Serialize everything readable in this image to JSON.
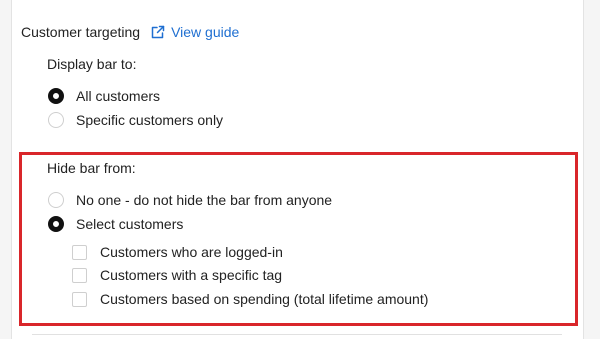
{
  "targeting": {
    "title": "Customer targeting",
    "guide_link": "View guide",
    "icon": "external-link-icon",
    "accent_color": "#1f6fd1"
  },
  "display_bar": {
    "label": "Display bar to:",
    "options": [
      {
        "label": "All customers",
        "selected": true
      },
      {
        "label": "Specific customers only",
        "selected": false
      }
    ]
  },
  "hide_bar": {
    "label": "Hide bar from:",
    "options": [
      {
        "label": "No one - do not hide the bar from anyone",
        "selected": false
      },
      {
        "label": "Select customers",
        "selected": true
      }
    ],
    "checkboxes": [
      {
        "label": "Customers who are logged-in",
        "checked": false
      },
      {
        "label": "Customers with a specific tag",
        "checked": false
      },
      {
        "label": "Customers based on spending (total lifetime amount)",
        "checked": false
      }
    ],
    "highlight_color": "#d9262a"
  }
}
